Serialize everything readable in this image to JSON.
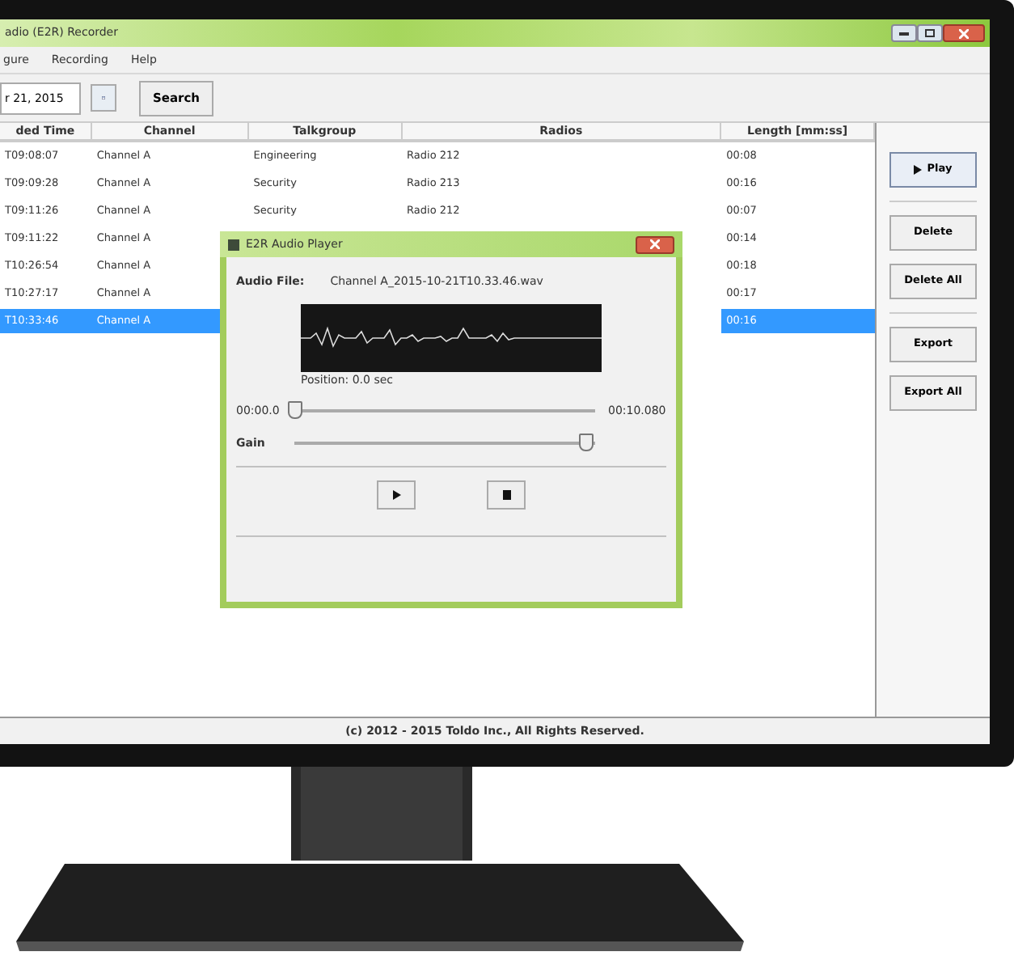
{
  "window": {
    "title": "adio (E2R) Recorder"
  },
  "menu": [
    "gure",
    "Recording",
    "Help"
  ],
  "toolbar": {
    "date": "r 21, 2015",
    "search_button": "Search"
  },
  "table": {
    "columns": [
      "ded Time",
      "Channel",
      "Talkgroup",
      "Radios",
      "Length [mm:ss]"
    ],
    "rows": [
      {
        "time": "T09:08:07",
        "channel": "Channel A",
        "talkgroup": "Engineering",
        "radio": "Radio 212",
        "length": "00:08",
        "selected": false
      },
      {
        "time": "T09:09:28",
        "channel": "Channel A",
        "talkgroup": "Security",
        "radio": "Radio 213",
        "length": "00:16",
        "selected": false
      },
      {
        "time": "T09:11:26",
        "channel": "Channel A",
        "talkgroup": "Security",
        "radio": "Radio 212",
        "length": "00:07",
        "selected": false
      },
      {
        "time": "T09:11:22",
        "channel": "Channel A",
        "length": "00:14",
        "selected": false
      },
      {
        "time": "T10:26:54",
        "channel": "Channel A",
        "length": "00:18",
        "selected": false
      },
      {
        "time": "T10:27:17",
        "channel": "Channel A",
        "length": "00:17",
        "selected": false
      },
      {
        "time": "T10:33:46",
        "channel": "Channel A",
        "length": "00:16",
        "selected": true
      }
    ]
  },
  "actions": [
    [
      {
        "label": "Play",
        "kind": "play"
      }
    ],
    [
      {
        "label": "Delete",
        "kind": "plain"
      },
      {
        "label": "Delete All",
        "kind": "plain"
      }
    ],
    [
      {
        "label": "Export",
        "kind": "plain"
      },
      {
        "label": "Export All",
        "kind": "plain"
      }
    ]
  ],
  "status_bar": "(c) 2012 - 2015 Toldo Inc., All Rights Reserved.",
  "dialog": {
    "title": "E2R Audio Player",
    "file_label": "Audio File:",
    "file_name": "Channel A_2015-10-21T10.33.46.wav",
    "position": "Position: 0.0 sec",
    "start_time": "00:00.0",
    "end_time": "00:10.080",
    "position_slider": {
      "level": 0
    },
    "gain_label": "Gain",
    "gain_slider": {
      "level": 0.97
    },
    "controls": [
      {
        "kind": "play"
      },
      {
        "kind": "stop"
      }
    ]
  }
}
